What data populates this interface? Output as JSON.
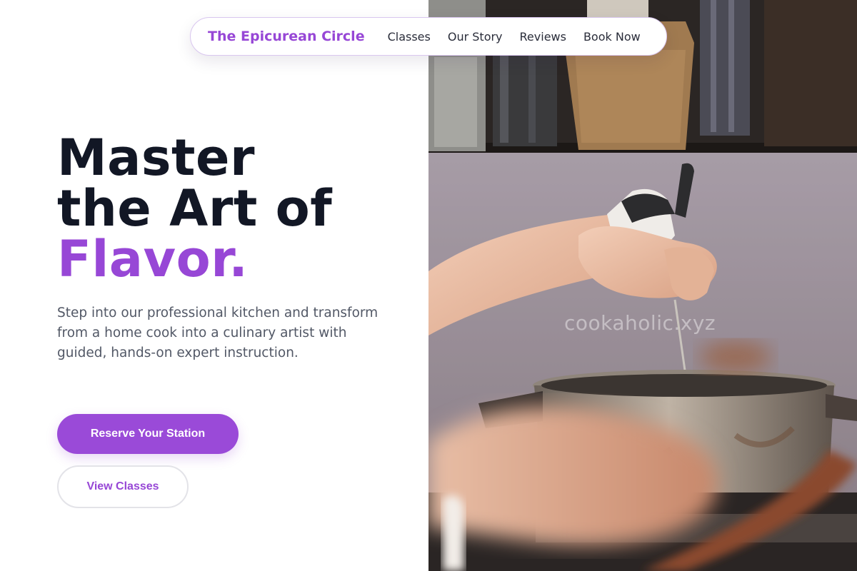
{
  "nav": {
    "brand": "The Epicurean Circle",
    "links": [
      "Classes",
      "Our Story",
      "Reviews",
      "Book Now"
    ]
  },
  "hero": {
    "headline_line1": "Master",
    "headline_line2": "the Art of",
    "headline_accent": "Flavor.",
    "description": "Step into our professional kitchen and transform from a home cook into a culinary artist with guided, hands-on expert instruction.",
    "primary_cta": "Reserve Your Station",
    "secondary_cta": "View Classes"
  },
  "photo": {
    "watermark": "cookaholic.xyz",
    "subject": "hands-seasoning-pot-photo"
  },
  "colors": {
    "accent": "#9747d6",
    "headline": "#121725",
    "body_text": "#525866",
    "button_primary": "#9a4ad8"
  }
}
